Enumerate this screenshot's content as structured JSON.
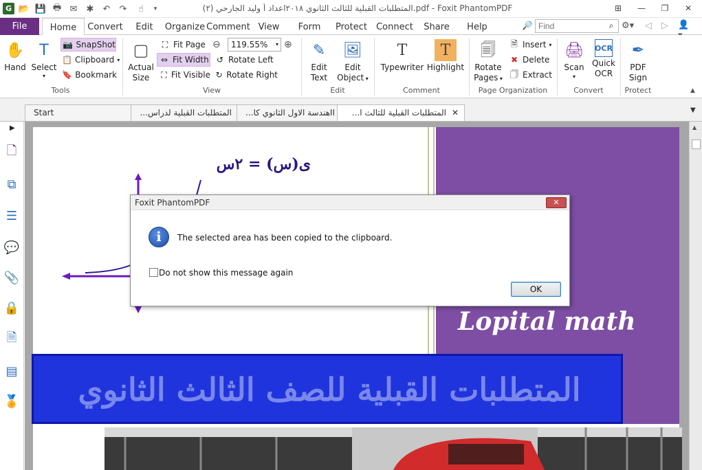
{
  "window": {
    "title": "(المتطلبات القبلية للثالث الثانوي ٢٠١٨اعداد أ وليد الجارحي (٢.pdf - Foxit PhantomPDF",
    "logo": "G"
  },
  "ribbon_tabs": [
    "File",
    "Home",
    "Convert",
    "Edit",
    "Organize",
    "Comment",
    "View",
    "Form",
    "Protect",
    "Connect",
    "Share",
    "Help"
  ],
  "active_tab": "Home",
  "find": {
    "placeholder": "Find"
  },
  "ribbon": {
    "tools": {
      "hand": "Hand",
      "select": "Select",
      "snapshot": "SnapShot",
      "clipboard": "Clipboard",
      "bookmark": "Bookmark",
      "group": "Tools"
    },
    "view": {
      "actual_size_1": "Actual",
      "actual_size_2": "Size",
      "fit_page": "Fit Page",
      "fit_width": "Fit Width",
      "fit_visible": "Fit Visible",
      "zoom": "119.55%",
      "rotate_left": "Rotate Left",
      "rotate_right": "Rotate Right",
      "group": "View"
    },
    "edit": {
      "edit_text_1": "Edit",
      "edit_text_2": "Text",
      "edit_object_1": "Edit",
      "edit_object_2": "Object",
      "group": "Edit"
    },
    "comment": {
      "typewriter": "Typewriter",
      "highlight": "Highlight",
      "group": "Comment"
    },
    "page_org": {
      "rotate_pages_1": "Rotate",
      "rotate_pages_2": "Pages",
      "insert": "Insert",
      "delete": "Delete",
      "extract": "Extract",
      "group": "Page Organization"
    },
    "convert": {
      "scan": "Scan",
      "quick_ocr_1": "Quick",
      "quick_ocr_2": "OCR",
      "group": "Convert"
    },
    "protect": {
      "pdf_sign_1": "PDF",
      "pdf_sign_2": "Sign",
      "group": "Protect"
    }
  },
  "doc_tabs": [
    {
      "label": "Start"
    },
    {
      "label": "...المتطلبات القبلية لدراس"
    },
    {
      "label": "...هندسة الاول الثانوي كاII"
    },
    {
      "label": "...المتطلبات القبلية للثالث ا"
    }
  ],
  "page": {
    "formula": "ى(س) = ٢س",
    "lopital": "Lopital math",
    "banner": "المتطلبات القبلية للصف الثالث الثانوي"
  },
  "dialog": {
    "title": "Foxit PhantomPDF",
    "message": "The selected area has been copied to the clipboard.",
    "checkbox_label": "Do not show this message again",
    "ok": "OK"
  },
  "colors": {
    "accent": "#6a2f83",
    "purple_panel": "#7d4ea4",
    "banner_blue": "#2034dd"
  }
}
